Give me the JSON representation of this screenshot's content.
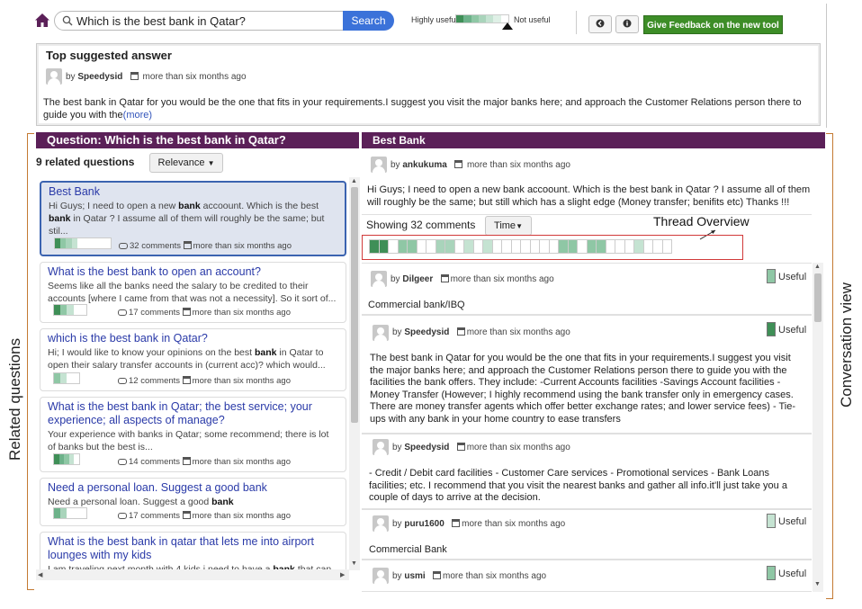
{
  "search": {
    "query": "Which is the best bank in Qatar?",
    "button": "Search"
  },
  "scale": {
    "left_label": "Highly useful",
    "right_label": "Not useful",
    "colors": [
      "#3f8f57",
      "#6db28a",
      "#8fc7a5",
      "#a9d4bb",
      "#c5e3d2",
      "#dff0e6",
      "#ffffff"
    ]
  },
  "toolbar": {
    "back_icon": "back-icon",
    "info_icon": "info-icon",
    "feedback": "Give Feedback on the new tool"
  },
  "top_answer": {
    "heading": "Top suggested answer",
    "by": "by",
    "author": "Speedysid",
    "time": "more than six months ago",
    "text": "The best bank in Qatar for you would be the one that fits in your requirements.I suggest you visit the major banks here; and approach the Customer Relations person there to guide you with the",
    "more": "(more)"
  },
  "labels": {
    "related": "Related questions",
    "conversation": "Conversation view",
    "thread_overview": "Thread Overview"
  },
  "left_panel": {
    "header": "Question: Which is the best bank in Qatar?",
    "count": "9 related questions",
    "sort": "Relevance",
    "items": [
      {
        "title": "Best Bank",
        "snippet_parts": [
          "Hi Guys; I need to open a new ",
          "bank",
          " accoount. Which is the best ",
          "bank",
          " in Qatar ? I assume all of them will roughly be the same; but stil..."
        ],
        "comments": "32 comments",
        "time": "more than six months ago",
        "bar": [
          "#3f8f57",
          "#8fc7a5",
          "#a9d4bb",
          "#c5e3d2",
          "#fff",
          "#fff",
          "#fff",
          "#fff",
          "#fff",
          "#fff"
        ]
      },
      {
        "title": "What is the best bank to open an account?",
        "snippet_parts": [
          "Seems like all the banks need the salary to be credited to their accounts [where I came from that was not a necessity]. So it sort of..."
        ],
        "comments": "17 comments",
        "time": "more than six months ago",
        "bar": [
          "#3f8f57",
          "#8fc7a5",
          "#c5e3d2",
          "#fff",
          "#fff"
        ]
      },
      {
        "title": "which is the best bank in Qatar?",
        "snippet_parts": [
          "Hi; I would like to know your opinions on the best ",
          "bank",
          " in Qatar to open their salary transfer accounts in (current acc)? which would..."
        ],
        "comments": "12 comments",
        "time": "more than six months ago",
        "bar": [
          "#8fc7a5",
          "#c5e3d2",
          "#fff",
          "#fff"
        ]
      },
      {
        "title": "What is the best bank in Qatar; the best service; your experience; all aspects of manage?",
        "snippet_parts": [
          "Your experience with banks in Qatar; some recommend; there is lot of banks but the best is..."
        ],
        "comments": "14 comments",
        "time": "more than six months ago",
        "bar": [
          "#3f8f57",
          "#6db28a",
          "#8fc7a5",
          "#c5e3d2",
          "#fff"
        ]
      },
      {
        "title": "Need a personal loan. Suggest a good bank",
        "snippet_parts": [
          "Need a personal loan. Suggest a good ",
          "bank"
        ],
        "comments": "17 comments",
        "time": "more than six months ago",
        "bar": [
          "#6db28a",
          "#a9d4bb",
          "#fff",
          "#fff",
          "#fff"
        ]
      },
      {
        "title": "What is the best bank in qatar that lets me into airport lounges with my kids",
        "snippet_parts": [
          "I am traveling next month with 4 kids i need to have a ",
          "bank",
          " that can"
        ],
        "comments": "",
        "time": "",
        "bar": []
      }
    ]
  },
  "right_panel": {
    "header": "Best Bank",
    "question": {
      "by": "by",
      "author": "ankukuma",
      "time": "more than six months ago",
      "text": "Hi Guys; I need to open a new bank accoount. Which is the best bank in Qatar ? I assume all of them will roughly be the same; but still which has a slight edge (Money transfer; benifits etc) Thanks !!!"
    },
    "showing": "Showing 32 comments",
    "sort": "Time",
    "thread_cells": [
      "#3f8f57",
      "#3f8f57",
      "#fff",
      "#8fc7a5",
      "#8fc7a5",
      "#fff",
      "#fff",
      "#a9d4bb",
      "#a9d4bb",
      "#fff",
      "#c5e3d2",
      "#fff",
      "#c5e3d2",
      "#fff",
      "#fff",
      "#fff",
      "#fff",
      "#fff",
      "#fff",
      "#fff",
      "#8fc7a5",
      "#8fc7a5",
      "#fff",
      "#8fc7a5",
      "#8fc7a5",
      "#fff",
      "#fff",
      "#fff",
      "#c5e3d2",
      "#fff",
      "#fff",
      "#fff"
    ],
    "comments": [
      {
        "author": "Dilgeer",
        "time": "more than six months ago",
        "text": "Commercial bank/IBQ",
        "useful": "Useful",
        "useful_color": "#8fc7a5"
      },
      {
        "author": "Speedysid",
        "time": "more than six months ago",
        "text": "The best bank in Qatar for you would be the one that fits in your requirements.I suggest you visit the major banks here; and approach the Customer Relations person there to guide you with the facilities the bank offers. They include: -Current Accounts facilities -Savings Account facilities - Money Transfer (However; I highly recommend using the bank transfer only in emergency cases. There are money transfer agents which offer better exchange rates; and lower service fees) - Tie-ups with any bank in your home country to ease transfers",
        "useful": "Useful",
        "useful_color": "#3f8f57"
      },
      {
        "author": "Speedysid",
        "time": "more than six months ago",
        "text": "- Credit / Debit card facilities - Customer Care services - Promotional services - Bank Loans facilities; etc. I recommend that you visit the nearest banks and gather all info.it'll just take you a couple of days to arrive at the decision.",
        "useful": "",
        "useful_color": ""
      },
      {
        "author": "puru1600",
        "time": "more than six months ago",
        "text": "Commercial Bank",
        "useful": "Useful",
        "useful_color": "#c5e3d2"
      },
      {
        "author": "usmi",
        "time": "more than six months ago",
        "text": "",
        "useful": "Useful",
        "useful_color": "#8fc7a5"
      }
    ]
  }
}
